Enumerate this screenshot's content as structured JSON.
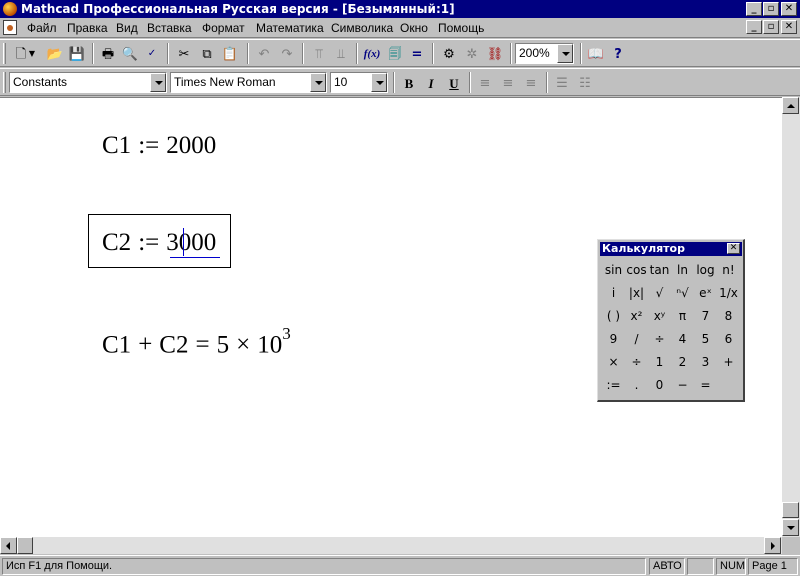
{
  "window": {
    "title": "Mathcad Профессиональная Русская версия - [Безымянный:1]"
  },
  "menu": {
    "items": [
      "Файл",
      "Правка",
      "Вид",
      "Вставка",
      "Формат",
      "Математика",
      "Символика",
      "Окно",
      "Помощь"
    ]
  },
  "toolbar": {
    "zoom": "200%",
    "function_label": "f(x)"
  },
  "format_bar": {
    "style": "Constants",
    "font": "Times New Roman",
    "size": "10",
    "bold": "B",
    "italic": "I",
    "underline": "U"
  },
  "worksheet": {
    "expr1": {
      "name": "C1",
      "op": ":=",
      "value": "2000"
    },
    "expr2": {
      "name": "C2",
      "op": ":=",
      "value_a": "3",
      "value_b": "000"
    },
    "expr3": {
      "a": "C1",
      "plus": "+",
      "b": "C2",
      "eq": "=",
      "mant": "5",
      "times": "×",
      "base": "10",
      "exp": "3"
    }
  },
  "calculator": {
    "title": "Калькулятор",
    "rows": [
      [
        "sin",
        "cos",
        "tan",
        "ln",
        "log",
        "n!"
      ],
      [
        "i",
        "|x|",
        "√",
        "ⁿ√",
        "eˣ",
        "1/x"
      ],
      [
        "( )",
        "x²",
        "xʸ",
        "π",
        "7",
        "8"
      ],
      [
        "9",
        "/",
        "÷",
        "4",
        "5",
        "6"
      ],
      [
        "×",
        "÷",
        "1",
        "2",
        "3",
        "+"
      ],
      [
        ":=",
        ".",
        "0",
        "−",
        "="
      ]
    ]
  },
  "status": {
    "help": "Исп F1 для Помощи.",
    "mode": "АВТО",
    "num": "NUM",
    "page": "Page 1"
  }
}
